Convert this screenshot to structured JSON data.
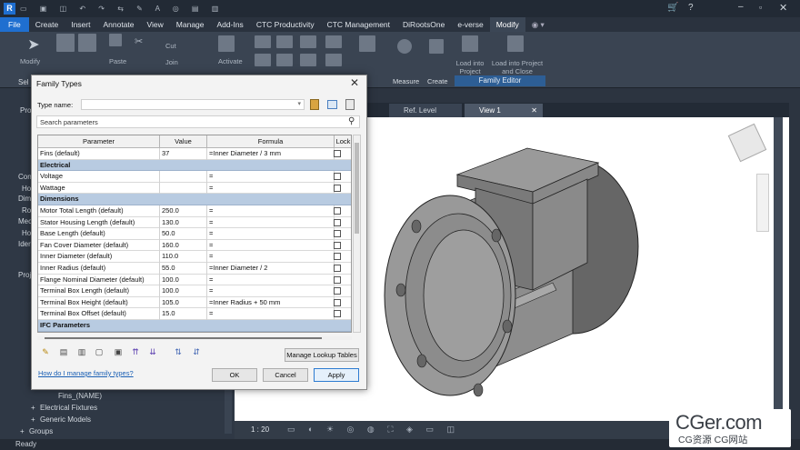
{
  "ribbon": {
    "tabs": [
      "File",
      "Create",
      "Insert",
      "Annotate",
      "View",
      "Manage",
      "Add-Ins",
      "CTC Productivity",
      "CTC Management",
      "DiRootsOne",
      "e-verse",
      "Modify"
    ],
    "active_tab": "Modify",
    "commands": {
      "modify": "Modify",
      "paste": "Paste",
      "cut": "Cut",
      "join": "Join",
      "activate": "Activate",
      "load_into_project": "Load into Project",
      "load_into_project_close": "Load into Project and Close",
      "measure": "Measure",
      "create": "Create"
    },
    "panel_family_editor": "Family Editor",
    "select_prefix": "Sel"
  },
  "left_panel": {
    "labels": [
      "Prop",
      "Con",
      "Ho",
      "Dim",
      "Ro",
      "Mec",
      "Ho",
      "Ider",
      "Proj"
    ],
    "tree": [
      "Fins_(NAME)",
      "Electrical Fixtures",
      "Generic Models",
      "Groups"
    ]
  },
  "view_tabs": [
    {
      "label": "Ref. Level"
    },
    {
      "label": "View 1"
    }
  ],
  "view_bar": {
    "scale": "1 : 20"
  },
  "status": {
    "text": "Ready"
  },
  "dialog": {
    "title": "Family Types",
    "type_name_label": "Type name:",
    "search_placeholder": "Search parameters",
    "columns": {
      "parameter": "Parameter",
      "value": "Value",
      "formula": "Formula",
      "lock": "Lock"
    },
    "rows": [
      {
        "kind": "row",
        "parameter": "Fins (default)",
        "value": "37",
        "formula": "=Inner Diameter / 3 mm"
      },
      {
        "kind": "group",
        "parameter": "Electrical"
      },
      {
        "kind": "row",
        "parameter": "Voltage",
        "value": "",
        "formula": "="
      },
      {
        "kind": "row",
        "parameter": "Wattage",
        "value": "",
        "formula": "="
      },
      {
        "kind": "group",
        "parameter": "Dimensions"
      },
      {
        "kind": "row",
        "parameter": "Motor Total Length (default)",
        "value": "250.0",
        "formula": "="
      },
      {
        "kind": "row",
        "parameter": "Stator Housing Length (default)",
        "value": "130.0",
        "formula": "="
      },
      {
        "kind": "row",
        "parameter": "Base Length (default)",
        "value": "50.0",
        "formula": "="
      },
      {
        "kind": "row",
        "parameter": "Fan Cover Diameter (default)",
        "value": "160.0",
        "formula": "="
      },
      {
        "kind": "row",
        "parameter": "Inner Diameter (default)",
        "value": "110.0",
        "formula": "="
      },
      {
        "kind": "row",
        "parameter": "Inner Radius (default)",
        "value": "55.0",
        "formula": "=Inner Diameter / 2"
      },
      {
        "kind": "row",
        "parameter": "Flange Nominal Diameter (default)",
        "value": "100.0",
        "formula": "="
      },
      {
        "kind": "row",
        "parameter": "Terminal Box Length (default)",
        "value": "100.0",
        "formula": "="
      },
      {
        "kind": "row",
        "parameter": "Terminal Box Height (default)",
        "value": "105.0",
        "formula": "=Inner Radius + 50 mm"
      },
      {
        "kind": "row",
        "parameter": "Terminal Box Offset (default)",
        "value": "15.0",
        "formula": "="
      },
      {
        "kind": "group",
        "parameter": "IFC Parameters"
      }
    ],
    "manage_lookup_label": "Manage Lookup Tables",
    "help_link": "How do I manage family types?",
    "ok_label": "OK",
    "cancel_label": "Cancel",
    "apply_label": "Apply"
  },
  "watermark": {
    "main": "CGer.com",
    "sub": "CG资源 CG网站"
  }
}
